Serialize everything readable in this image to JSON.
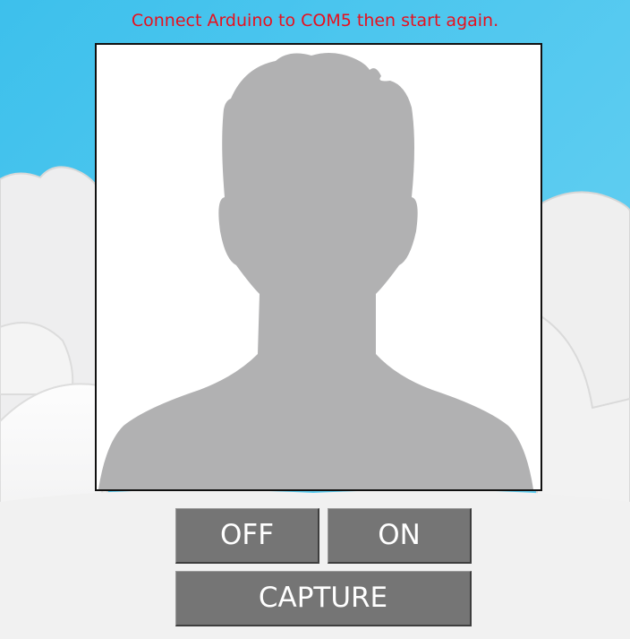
{
  "status_message": "Connect Arduino to COM5 then start again.",
  "colors": {
    "sky": "#4fc6ec",
    "status_text": "#e8101e",
    "button_bg": "#757575",
    "button_text": "#ffffff",
    "silhouette": "#b1b1b2"
  },
  "photo": {
    "placeholder_icon": "person-silhouette-icon"
  },
  "buttons": {
    "off_label": "OFF",
    "on_label": "ON",
    "capture_label": "CAPTURE"
  }
}
